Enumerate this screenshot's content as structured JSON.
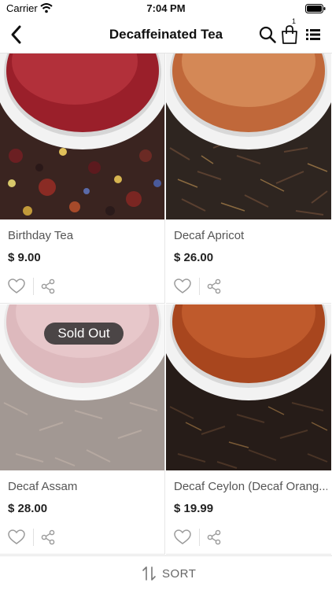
{
  "status_bar": {
    "carrier": "Carrier",
    "time": "7:04 PM"
  },
  "nav": {
    "title": "Decaffeinated Tea",
    "cart_count": "1"
  },
  "products": [
    {
      "name": "Birthday Tea",
      "price": "$ 9.00",
      "sold_out": false
    },
    {
      "name": "Decaf Apricot",
      "price": "$ 26.00",
      "sold_out": false
    },
    {
      "name": "Decaf Assam",
      "price": "$ 28.00",
      "sold_out": true,
      "badge": "Sold Out"
    },
    {
      "name": "Decaf Ceylon (Decaf Orang...",
      "price": "$ 19.99",
      "sold_out": false
    }
  ],
  "sort": {
    "label": "SORT"
  },
  "colors": {
    "text": "#111111",
    "muted": "#555555",
    "icon": "#9a9a9a",
    "badge_bg": "#333333"
  },
  "icons": [
    "wifi-icon",
    "battery-icon",
    "back-icon",
    "search-icon",
    "cart-icon",
    "menu-icon",
    "heart-icon",
    "share-icon",
    "sort-icon"
  ]
}
